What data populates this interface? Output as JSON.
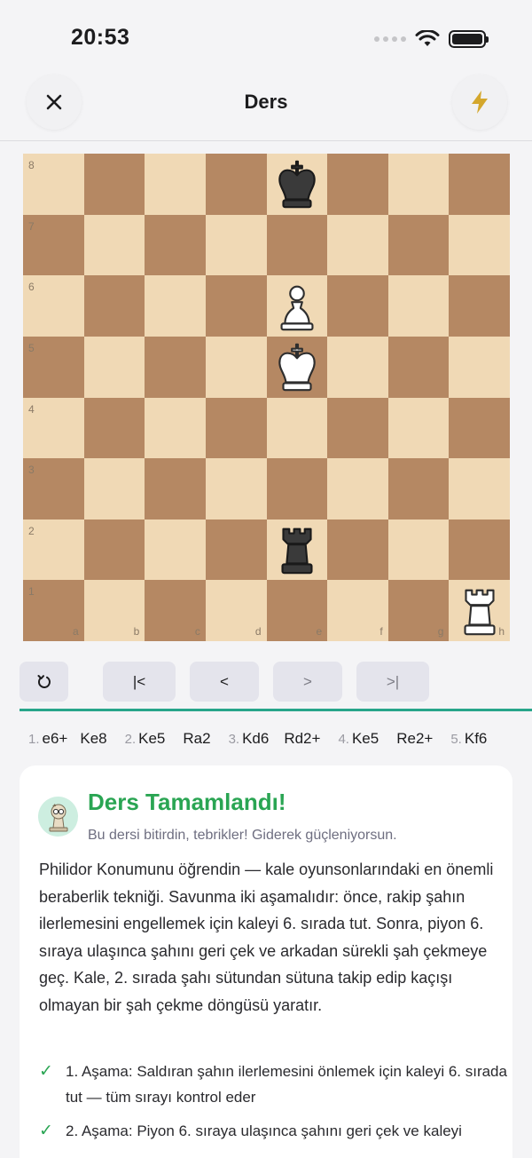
{
  "status": {
    "time": "20:53"
  },
  "header": {
    "title": "Ders",
    "close_icon": "close-icon",
    "action_icon": "bolt-icon",
    "accent": "#d4a72c"
  },
  "board": {
    "ranks": [
      "8",
      "7",
      "6",
      "5",
      "4",
      "3",
      "2",
      "1"
    ],
    "files": [
      "a",
      "b",
      "c",
      "d",
      "e",
      "f",
      "g",
      "h"
    ],
    "light": "#f0d9b5",
    "dark": "#b58863",
    "pieces": [
      {
        "square": "e8",
        "type": "king",
        "color": "black"
      },
      {
        "square": "e6",
        "type": "pawn",
        "color": "white"
      },
      {
        "square": "e5",
        "type": "king",
        "color": "white"
      },
      {
        "square": "e2",
        "type": "rook",
        "color": "black"
      },
      {
        "square": "h1",
        "type": "rook",
        "color": "white"
      }
    ]
  },
  "controls": {
    "reset_icon": "reset-icon",
    "first": "|<",
    "prev": "<",
    "next": ">",
    "last": ">|"
  },
  "moves": [
    {
      "num": "1.",
      "white": "e6+",
      "black": "Ke8"
    },
    {
      "num": "2.",
      "white": "Ke5",
      "black": "Ra2"
    },
    {
      "num": "3.",
      "white": "Kd6",
      "black": "Rd2+"
    },
    {
      "num": "4.",
      "white": "Ke5",
      "black": "Re2+"
    },
    {
      "num": "5.",
      "white": "Kf6",
      "black": ""
    }
  ],
  "lesson": {
    "title": "Ders Tamamlandı!",
    "subtitle": "Bu dersi bitirdin, tebrikler! Giderek güçleniyorsun.",
    "body": "Philidor Konumunu öğrendin — kale oyunsonlarındaki en önemli beraberlik tekniği. Savunma iki aşamalıdır: önce, rakip şahın ilerlemesini engellemek için kaleyi 6. sırada tut. Sonra, piyon 6. sıraya ulaşınca şahını geri çek ve arkadan sürekli şah çekmeye geç. Kale, 2. sırada şahı sütundan sütuna takip edip kaçışı olmayan bir şah çekme döngüsü yaratır.",
    "steps": [
      "1. Aşama: Saldıran şahın ilerlemesini önlemek için kaleyi 6. sırada tut — tüm sırayı kontrol eder",
      "2. Aşama: Piyon 6. sıraya ulaşınca şahını geri çek ve kaleyi"
    ],
    "accent": "#2aa553"
  }
}
